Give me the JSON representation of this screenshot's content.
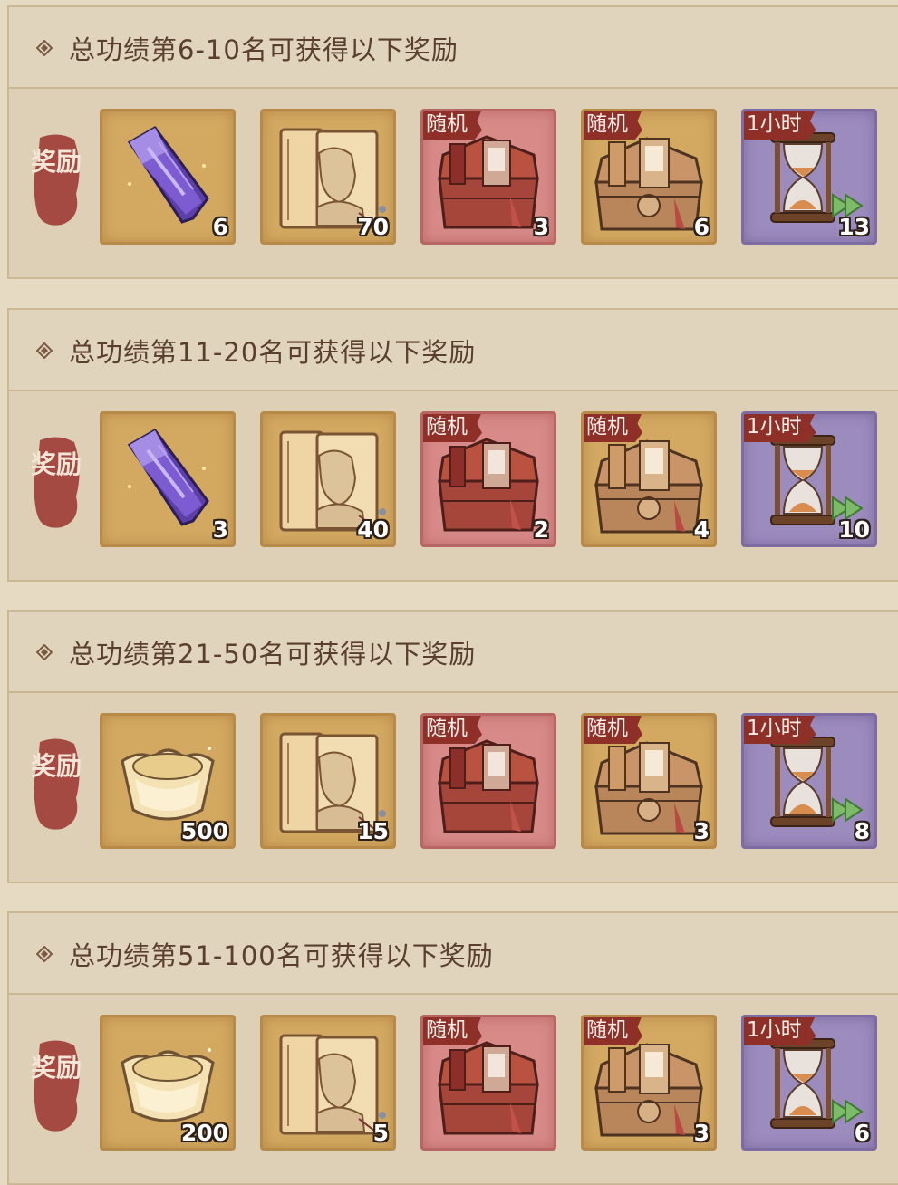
{
  "reward_label": "奖励",
  "colors": {
    "panel": "#ddd0b6",
    "title_text": "#5a3f2e",
    "stamp": "#a54a42",
    "tag": "#8e3028"
  },
  "tiers": [
    {
      "title": "总功绩第6-10名可获得以下奖励",
      "items": [
        {
          "icon": "purple-crystal-icon",
          "frame": "gold",
          "count": "6"
        },
        {
          "icon": "portrait-book-icon",
          "frame": "gold",
          "count": "70"
        },
        {
          "icon": "red-chest-icon",
          "frame": "red",
          "tag": "随机",
          "count": "3"
        },
        {
          "icon": "wood-chest-icon",
          "frame": "gold",
          "tag": "随机",
          "count": "6"
        },
        {
          "icon": "hourglass-icon",
          "frame": "purple",
          "tag": "1小时",
          "count": "13"
        }
      ]
    },
    {
      "title": "总功绩第11-20名可获得以下奖励",
      "items": [
        {
          "icon": "purple-crystal-icon",
          "frame": "gold",
          "count": "3"
        },
        {
          "icon": "portrait-book-icon",
          "frame": "gold",
          "count": "40"
        },
        {
          "icon": "red-chest-icon",
          "frame": "red",
          "tag": "随机",
          "count": "2"
        },
        {
          "icon": "wood-chest-icon",
          "frame": "gold",
          "tag": "随机",
          "count": "4"
        },
        {
          "icon": "hourglass-icon",
          "frame": "purple",
          "tag": "1小时",
          "count": "10"
        }
      ]
    },
    {
      "title": "总功绩第21-50名可获得以下奖励",
      "items": [
        {
          "icon": "gold-ingot-icon",
          "frame": "gold",
          "count": "500"
        },
        {
          "icon": "portrait-book-icon",
          "frame": "gold",
          "count": "15"
        },
        {
          "icon": "red-chest-icon",
          "frame": "red",
          "tag": "随机",
          "count": ""
        },
        {
          "icon": "wood-chest-icon",
          "frame": "gold",
          "tag": "随机",
          "count": "3"
        },
        {
          "icon": "hourglass-icon",
          "frame": "purple",
          "tag": "1小时",
          "count": "8"
        }
      ]
    },
    {
      "title": "总功绩第51-100名可获得以下奖励",
      "items": [
        {
          "icon": "gold-ingot-icon",
          "frame": "gold",
          "count": "200"
        },
        {
          "icon": "portrait-book-icon",
          "frame": "gold",
          "count": "5"
        },
        {
          "icon": "red-chest-icon",
          "frame": "red",
          "tag": "随机",
          "count": ""
        },
        {
          "icon": "wood-chest-icon",
          "frame": "gold",
          "tag": "随机",
          "count": "3"
        },
        {
          "icon": "hourglass-icon",
          "frame": "purple",
          "tag": "1小时",
          "count": "6"
        }
      ]
    }
  ]
}
